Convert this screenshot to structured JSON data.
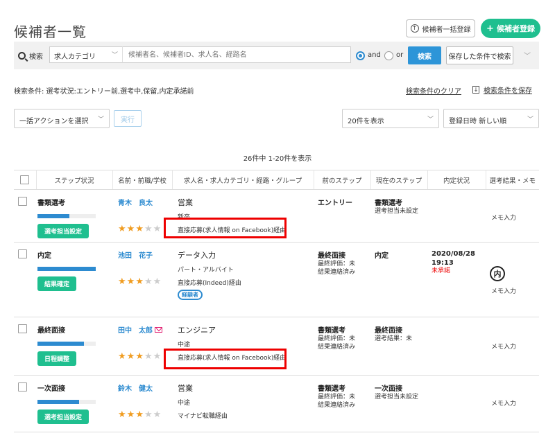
{
  "page": {
    "title": "候補者一覧"
  },
  "header": {
    "bulk_register_label": "候補者一括登録",
    "register_label": "候補者登録"
  },
  "search": {
    "label": "検索",
    "category_placeholder": "求人カテゴリ",
    "keyword_placeholder": "候補者名、候補者ID、求人名、経路名",
    "and_label": "and",
    "or_label": "or",
    "search_button": "検索",
    "saved_search_button": "保存した条件で検索"
  },
  "conditions": {
    "text": "検索条件:  選考状況:エントリー前,選考中,保留,内定承諾前",
    "clear_link": "検索条件のクリア",
    "save_link": "検索条件を保存"
  },
  "toolbar": {
    "bulk_action_placeholder": "一括アクションを選択",
    "execute_label": "実行",
    "per_page": "20件を表示",
    "sort": "登録日時 新しい順"
  },
  "pagination": {
    "count_text": "26件中 1-20件を表示"
  },
  "table": {
    "headers": [
      "ステップ状況",
      "名前・前職/学校",
      "求人名・求人カテゴリ・経路・グループ",
      "前のステップ",
      "現在のステップ",
      "内定状況",
      "選考結果・メモ"
    ],
    "rows": [
      {
        "step": "書類選考",
        "progress": 0.55,
        "action": "選考担当設定",
        "name": "青木　良太",
        "rating": 3,
        "job": "営業",
        "category": "新卒",
        "route": "直接応募(求人情報 on Facebook)経由",
        "prev_step": "エントリー",
        "prev_sub1": "",
        "prev_sub2": "",
        "cur_step": "書類選考",
        "cur_sub": "選考担当未設定",
        "offer_date": "",
        "offer_time": "",
        "offer_status": "",
        "memo": "メモ入力"
      },
      {
        "step": "内定",
        "progress": 1.0,
        "action": "結果確定",
        "name": "池田　花子",
        "rating": 3,
        "job": "データ入力",
        "category": "パート・アルバイト",
        "route": "直接応募(Indeed)経由",
        "tag": "経験者",
        "prev_step": "最終面接",
        "prev_sub1": "最終評価：未",
        "prev_sub2": "結果連絡済み",
        "cur_step": "内定",
        "cur_sub": "",
        "offer_date": "2020/08/28",
        "offer_time": "19:13",
        "offer_status": "未承諾",
        "badge": "内",
        "memo": "メモ入力"
      },
      {
        "step": "最終面接",
        "progress": 0.8,
        "action": "日程調整",
        "name": "田中　太郎",
        "rating": 3,
        "job": "エンジニア",
        "category": "中途",
        "route": "直接応募(求人情報 on Facebook)経由",
        "prev_step": "書類選考",
        "prev_sub1": "最終評価：未",
        "prev_sub2": "結果連絡済み",
        "cur_step": "最終面接",
        "cur_sub": "選考結果：未",
        "offer_date": "",
        "offer_time": "",
        "offer_status": "",
        "memo": "メモ入力"
      },
      {
        "step": "一次面接",
        "progress": 0.72,
        "action": "選考担当設定",
        "name": "鈴木　健太",
        "rating": 3,
        "job": "営業",
        "category": "中途",
        "route": "マイナビ転職経由",
        "prev_step": "書類選考",
        "prev_sub1": "最終評価：未",
        "prev_sub2": "結果連絡済み",
        "cur_step": "一次面接",
        "cur_sub": "選考担当未設定",
        "offer_date": "",
        "offer_time": "",
        "offer_status": "",
        "memo": "メモ入力"
      }
    ]
  },
  "colors": {
    "accent_green": "#1fbf8f",
    "accent_blue": "#2d8bd0",
    "star": "#f09c20",
    "highlight": "#e00000"
  }
}
